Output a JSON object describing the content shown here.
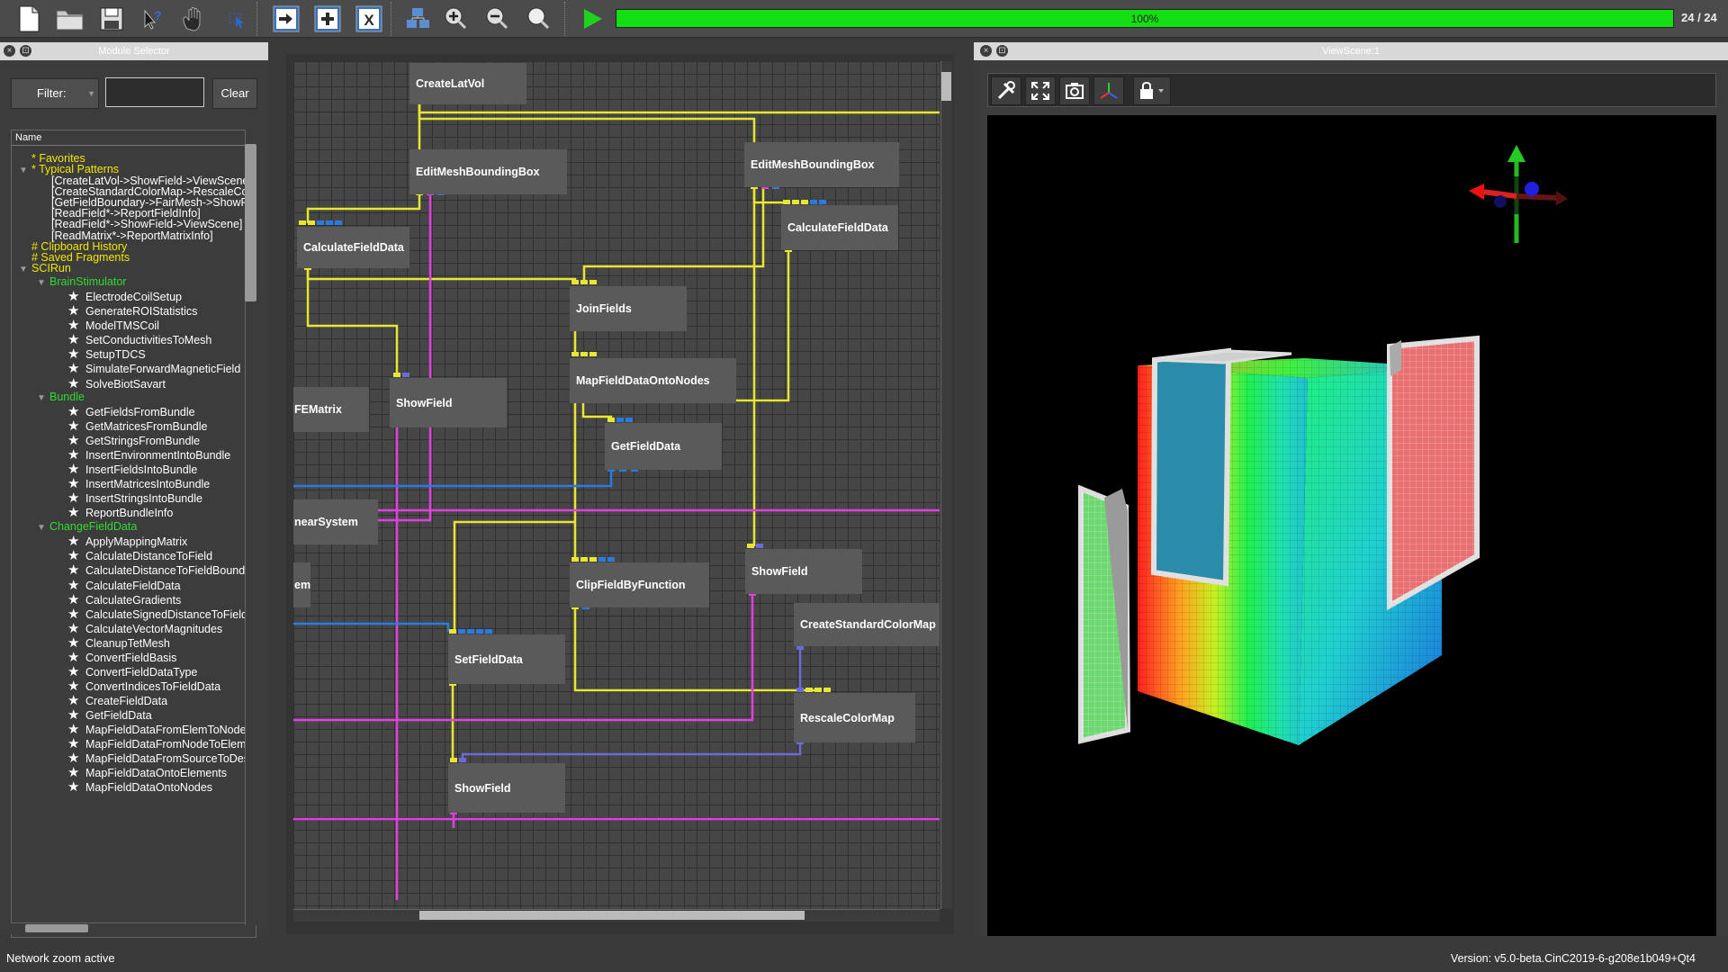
{
  "toolbar": {
    "progress_percent": 100,
    "progress_label": "100%",
    "progress_count": "24 / 24"
  },
  "module_panel": {
    "title": "Module Selector",
    "filter_label": "Filter:",
    "filter_value": "",
    "clear_label": "Clear",
    "tree_header": "Name"
  },
  "tree": [
    {
      "text": "* Favorites",
      "color": "#f2e600",
      "indent": 22,
      "tri": ""
    },
    {
      "text": "* Typical Patterns",
      "color": "#f2e600",
      "indent": 8,
      "tri": "▼"
    },
    {
      "text": "[CreateLatVol->ShowField->ViewScene]",
      "color": "#ffffff",
      "indent": 44,
      "tri": ""
    },
    {
      "text": "[CreateStandardColorMap->RescaleColorMap]",
      "color": "#ffffff",
      "indent": 44,
      "tri": ""
    },
    {
      "text": "[GetFieldBoundary->FairMesh->ShowField]",
      "color": "#ffffff",
      "indent": 44,
      "tri": ""
    },
    {
      "text": "[ReadField*->ReportFieldInfo]",
      "color": "#ffffff",
      "indent": 44,
      "tri": ""
    },
    {
      "text": "[ReadField*->ShowField->ViewScene]",
      "color": "#ffffff",
      "indent": 44,
      "tri": ""
    },
    {
      "text": "[ReadMatrix*->ReportMatrixInfo]",
      "color": "#ffffff",
      "indent": 44,
      "tri": ""
    },
    {
      "text": "# Clipboard History",
      "color": "#f2e600",
      "indent": 22,
      "tri": ""
    },
    {
      "text": "# Saved Fragments",
      "color": "#f2e600",
      "indent": 22,
      "tri": ""
    },
    {
      "text": "SCIRun",
      "color": "#f2e600",
      "indent": 8,
      "tri": "▼"
    },
    {
      "text": "BrainStimulator",
      "color": "#2edb2e",
      "indent": 28,
      "tri": "▼"
    },
    {
      "text": "ElectrodeCoilSetup",
      "color": "#ffffff",
      "indent": 64,
      "star": true
    },
    {
      "text": "GenerateROIStatistics",
      "color": "#ffffff",
      "indent": 64,
      "star": true
    },
    {
      "text": "ModelTMSCoil",
      "color": "#ffffff",
      "indent": 64,
      "star": true
    },
    {
      "text": "SetConductivitiesToMesh",
      "color": "#ffffff",
      "indent": 64,
      "star": true
    },
    {
      "text": "SetupTDCS",
      "color": "#ffffff",
      "indent": 64,
      "star": true
    },
    {
      "text": "SimulateForwardMagneticField",
      "color": "#ffffff",
      "indent": 64,
      "star": true
    },
    {
      "text": "SolveBiotSavart",
      "color": "#ffffff",
      "indent": 64,
      "star": true
    },
    {
      "text": "Bundle",
      "color": "#2edb2e",
      "indent": 28,
      "tri": "▼"
    },
    {
      "text": "GetFieldsFromBundle",
      "color": "#ffffff",
      "indent": 64,
      "star": true
    },
    {
      "text": "GetMatricesFromBundle",
      "color": "#ffffff",
      "indent": 64,
      "star": true
    },
    {
      "text": "GetStringsFromBundle",
      "color": "#ffffff",
      "indent": 64,
      "star": true
    },
    {
      "text": "InsertEnvironmentIntoBundle",
      "color": "#ffffff",
      "indent": 64,
      "star": true
    },
    {
      "text": "InsertFieldsIntoBundle",
      "color": "#ffffff",
      "indent": 64,
      "star": true
    },
    {
      "text": "InsertMatricesIntoBundle",
      "color": "#ffffff",
      "indent": 64,
      "star": true
    },
    {
      "text": "InsertStringsIntoBundle",
      "color": "#ffffff",
      "indent": 64,
      "star": true
    },
    {
      "text": "ReportBundleInfo",
      "color": "#ffffff",
      "indent": 64,
      "star": true
    },
    {
      "text": "ChangeFieldData",
      "color": "#2edb2e",
      "indent": 28,
      "tri": "▼"
    },
    {
      "text": "ApplyMappingMatrix",
      "color": "#ffffff",
      "indent": 64,
      "star": true
    },
    {
      "text": "CalculateDistanceToField",
      "color": "#ffffff",
      "indent": 64,
      "star": true
    },
    {
      "text": "CalculateDistanceToFieldBoundary",
      "color": "#ffffff",
      "indent": 64,
      "star": true
    },
    {
      "text": "CalculateFieldData",
      "color": "#ffffff",
      "indent": 64,
      "star": true
    },
    {
      "text": "CalculateGradients",
      "color": "#ffffff",
      "indent": 64,
      "star": true
    },
    {
      "text": "CalculateSignedDistanceToField",
      "color": "#ffffff",
      "indent": 64,
      "star": true
    },
    {
      "text": "CalculateVectorMagnitudes",
      "color": "#ffffff",
      "indent": 64,
      "star": true
    },
    {
      "text": "CleanupTetMesh",
      "color": "#ffffff",
      "indent": 64,
      "star": true
    },
    {
      "text": "ConvertFieldBasis",
      "color": "#ffffff",
      "indent": 64,
      "star": true
    },
    {
      "text": "ConvertFieldDataType",
      "color": "#ffffff",
      "indent": 64,
      "star": true
    },
    {
      "text": "ConvertIndicesToFieldData",
      "color": "#ffffff",
      "indent": 64,
      "star": true
    },
    {
      "text": "CreateFieldData",
      "color": "#ffffff",
      "indent": 64,
      "star": true
    },
    {
      "text": "GetFieldData",
      "color": "#ffffff",
      "indent": 64,
      "star": true
    },
    {
      "text": "MapFieldDataFromElemToNode",
      "color": "#ffffff",
      "indent": 64,
      "star": true
    },
    {
      "text": "MapFieldDataFromNodeToElem",
      "color": "#ffffff",
      "indent": 64,
      "star": true
    },
    {
      "text": "MapFieldDataFromSourceToDestination",
      "color": "#ffffff",
      "indent": 64,
      "star": true
    },
    {
      "text": "MapFieldDataOntoElements",
      "color": "#ffffff",
      "indent": 64,
      "star": true
    },
    {
      "text": "MapFieldDataOntoNodes",
      "color": "#ffffff",
      "indent": 64,
      "star": true
    }
  ],
  "network": {
    "modules": [
      {
        "label": "CreateLatVol"
      },
      {
        "label": "EditMeshBoundingBox"
      },
      {
        "label": "EditMeshBoundingBox"
      },
      {
        "label": "CalculateFieldData"
      },
      {
        "label": "CalculateFieldData"
      },
      {
        "label": "JoinFields"
      },
      {
        "label": "MapFieldDataOntoNodes"
      },
      {
        "label": "FEMatrix"
      },
      {
        "label": "ShowField"
      },
      {
        "label": "GetFieldData"
      },
      {
        "label": "nearSystem"
      },
      {
        "label": "em"
      },
      {
        "label": "ClipFieldByFunction"
      },
      {
        "label": "ShowField"
      },
      {
        "label": "CreateStandardColorMap"
      },
      {
        "label": "SetFieldData"
      },
      {
        "label": "RescaleColorMap"
      },
      {
        "label": "ShowField"
      }
    ],
    "wire_colors": {
      "field": "#e6e633",
      "geometry": "#e040e0",
      "colormap": "#6a6ad8",
      "matrix": "#2a7ae0"
    }
  },
  "viewscene": {
    "title": "ViewScene:1"
  },
  "status": {
    "left": "Network zoom active",
    "right": "Version: v5.0-beta.CinC2019-6-g208e1b049+Qt4"
  }
}
